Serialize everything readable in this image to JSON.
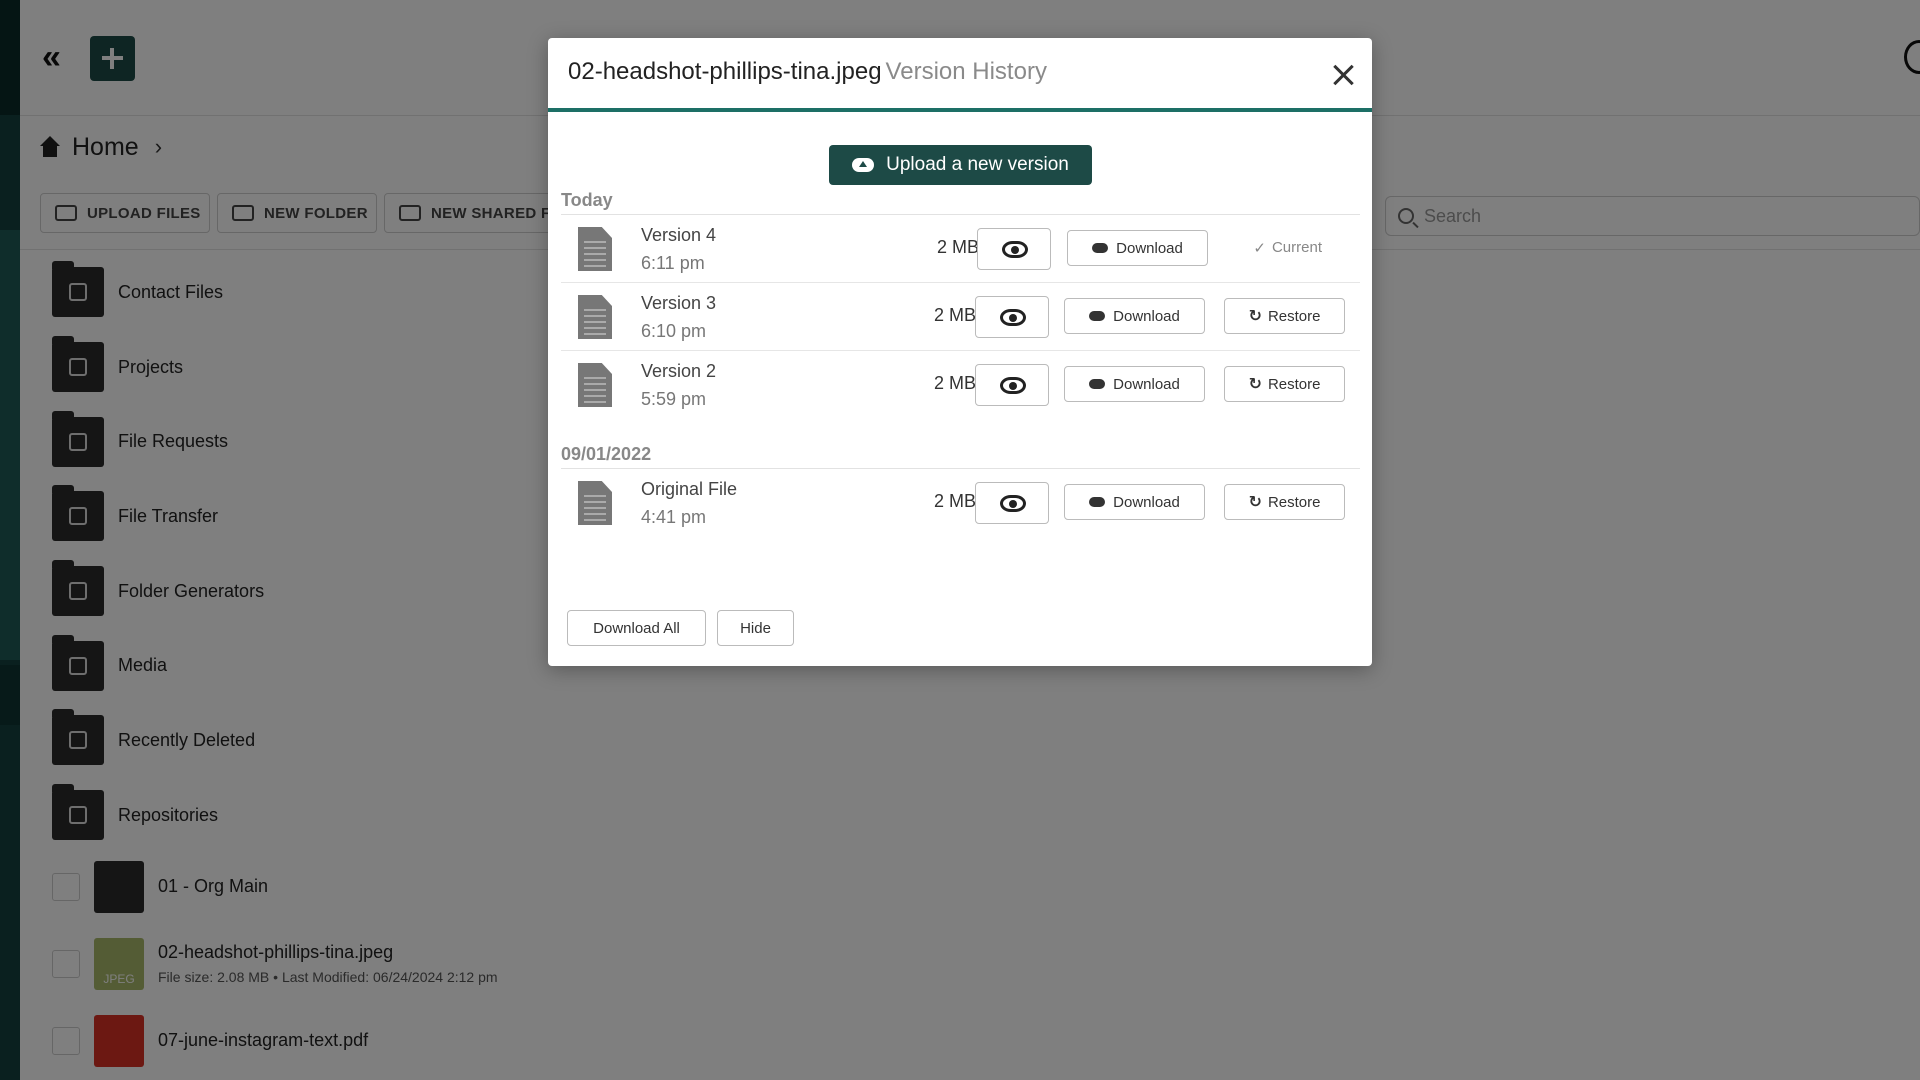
{
  "app": {
    "breadcrumb": {
      "home_label": "Home"
    },
    "toolbar": {
      "upload_files": "UPLOAD FILES",
      "new_folder": "NEW FOLDER",
      "new_shared": "NEW SHARED F",
      "search_placeholder": "Search"
    },
    "folders": [
      {
        "label": "Contact Files",
        "icon": "person-icon"
      },
      {
        "label": "Projects",
        "icon": "list-icon"
      },
      {
        "label": "File Requests",
        "icon": "open-folder-icon"
      },
      {
        "label": "File Transfer",
        "icon": "send-icon"
      },
      {
        "label": "Folder Generators",
        "icon": "tree-icon"
      },
      {
        "label": "Media",
        "icon": "images-icon"
      },
      {
        "label": "Recently Deleted",
        "icon": "trash-clock-icon"
      },
      {
        "label": "Repositories",
        "icon": "cabinet-icon"
      }
    ],
    "files": [
      {
        "name": "01 - Org Main",
        "meta": "",
        "type": "folder"
      },
      {
        "name": "02-headshot-phillips-tina.jpeg",
        "size": "File size: 2.08 MB",
        "modified": "Last Modified: 06/24/2024 2:12 pm",
        "type": "jpeg",
        "thumb_label": "JPEG"
      },
      {
        "name": "07-june-instagram-text.pdf",
        "meta": "",
        "type": "pdf"
      }
    ]
  },
  "modal": {
    "file_name": "02-headshot-phillips-tina.jpeg",
    "subtitle": "Version History",
    "upload_label": "Upload a new version",
    "groups": [
      {
        "label": "Today",
        "versions": [
          {
            "name": "Version 4",
            "time": "6:11 pm",
            "size": "2 MB",
            "download": "Download",
            "status": "Current"
          },
          {
            "name": "Version 3",
            "time": "6:10 pm",
            "size": "2 MB",
            "download": "Download",
            "restore": "Restore"
          },
          {
            "name": "Version 2",
            "time": "5:59 pm",
            "size": "2 MB",
            "download": "Download",
            "restore": "Restore"
          }
        ]
      },
      {
        "label": "09/01/2022",
        "versions": [
          {
            "name": "Original File",
            "time": "4:41 pm",
            "size": "2 MB",
            "download": "Download",
            "restore": "Restore"
          }
        ]
      }
    ],
    "download_all": "Download All",
    "hide": "Hide"
  },
  "colors": {
    "brand_dark": "#1d4a46",
    "accent_teal": "#1d6f66",
    "overlay": "rgba(0,0,0,0.5)"
  }
}
